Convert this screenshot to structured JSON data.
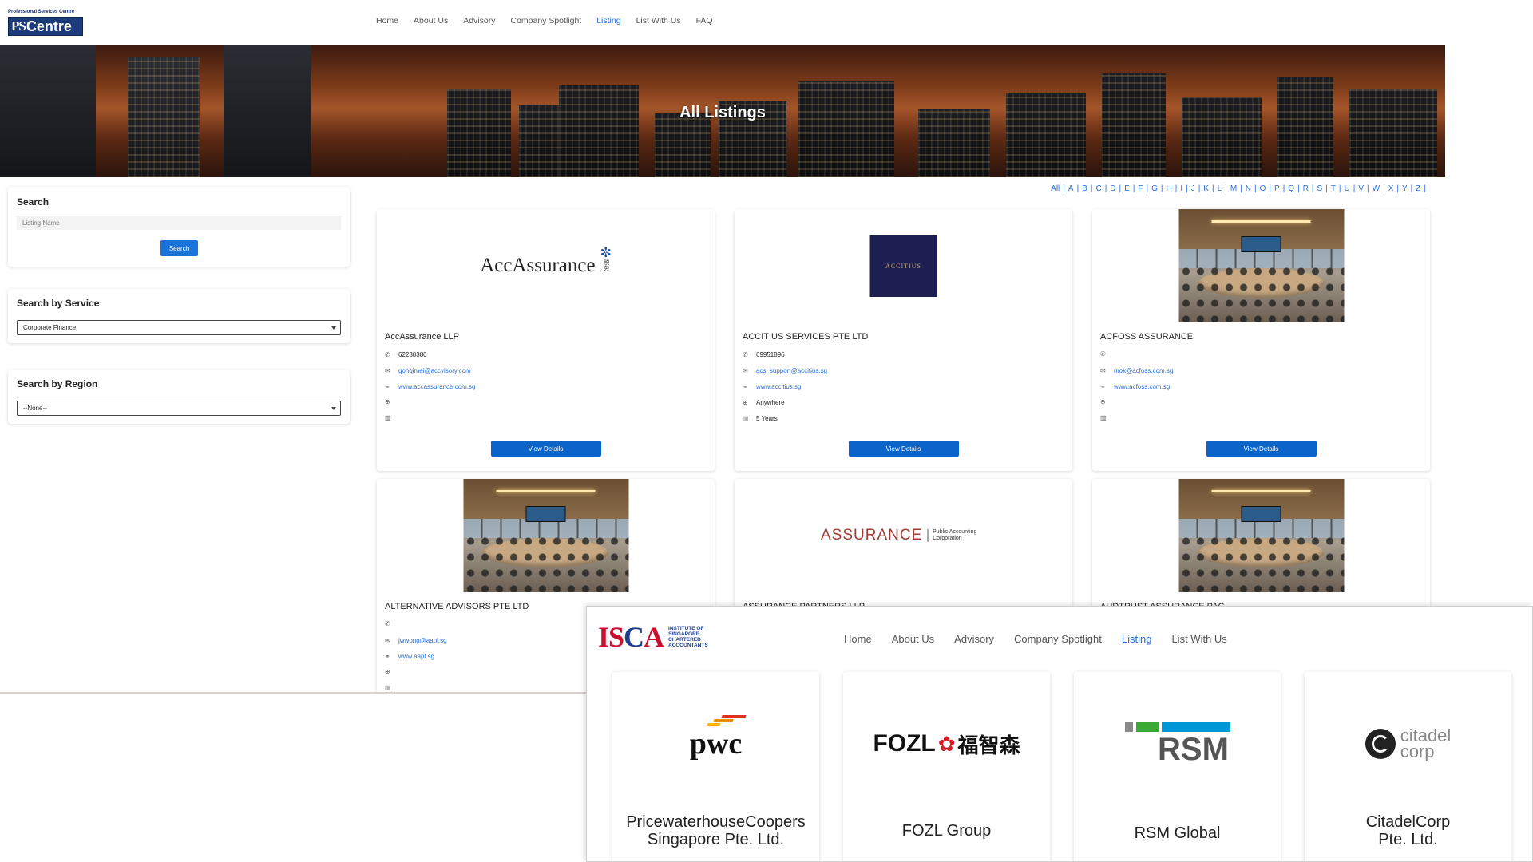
{
  "main": {
    "logo": {
      "top_text": "Professional Services Centre",
      "ps": "PS",
      "centre": "Centre"
    },
    "nav": [
      "Home",
      "About Us",
      "Advisory",
      "Company Spotlight",
      "Listing",
      "List With Us",
      "FAQ"
    ],
    "nav_active": "Listing",
    "hero_title": "All Listings",
    "search": {
      "title": "Search",
      "placeholder": "Listing Name",
      "button": "Search"
    },
    "service": {
      "title": "Search by Service",
      "value": "Corporate Finance"
    },
    "region": {
      "title": "Search by Region",
      "value": "--None--"
    },
    "alphabet": [
      "All",
      "A",
      "B",
      "C",
      "D",
      "E",
      "F",
      "G",
      "H",
      "I",
      "J",
      "K",
      "L",
      "M",
      "N",
      "O",
      "P",
      "Q",
      "R",
      "S",
      "T",
      "U",
      "V",
      "W",
      "X",
      "Y",
      "Z"
    ],
    "listings": [
      {
        "name": "AccAssurance LLP",
        "logo_text": "AccAssurance",
        "logo_side": "税务",
        "phone": "62238380",
        "email": "gohqimei@accvisory.com",
        "website": "www.accassurance.com.sg",
        "region": "",
        "experience": "",
        "button": "View Details"
      },
      {
        "name": "ACCITIUS SERVICES PTE LTD",
        "logo_text": "ACCITIUS",
        "phone": "69951896",
        "email": "acs_support@accitius.sg",
        "website": "www.accitius.sg",
        "region": "Anywhere",
        "experience": "5 Years",
        "button": "View Details"
      },
      {
        "name": "ACFOSS ASSURANCE",
        "phone": "",
        "email": "mok@acfoss.com.sg",
        "website": "www.acfoss.com.sg",
        "region": "",
        "experience": "",
        "button": "View Details"
      },
      {
        "name": "ALTERNATIVE ADVISORS PTE LTD",
        "phone": "",
        "email": "jwwong@aapl.sg",
        "website": "www.aapl.sg",
        "region": "",
        "experience": ""
      },
      {
        "name": "ASSURANCE PARTNERS LLP",
        "logo_text": "ASSURANCE",
        "logo_sub": "Public Accounting Corporation"
      },
      {
        "name": "AUDTRUST ASSURANCE PAC"
      }
    ]
  },
  "overlay": {
    "logo": {
      "word_a": "IS",
      "word_c": "C",
      "word_b": "A",
      "sub": [
        "INSTITUTE OF",
        "SINGAPORE",
        "CHARTERED",
        "ACCOUNTANTS"
      ]
    },
    "nav": [
      "Home",
      "About Us",
      "Advisory",
      "Company Spotlight",
      "Listing",
      "List With Us"
    ],
    "nav_active": "Listing",
    "cards": [
      {
        "name_l1": "PricewaterhouseCoopers",
        "name_l2": "Singapore Pte. Ltd.",
        "logo": "pwc"
      },
      {
        "name_l1": "FOZL Group",
        "name_l2": "",
        "logo": "FOZL",
        "logo_cn": "福智森"
      },
      {
        "name_l1": "RSM Global",
        "name_l2": "",
        "logo": "RSM"
      },
      {
        "name_l1": "CitadelCorp",
        "name_l2": "Pte. Ltd.",
        "logo_l1": "citadel",
        "logo_l2": "corp"
      }
    ]
  },
  "colors": {
    "accent": "#2a6fdb",
    "button": "#0c63c9",
    "isca_red": "#c8102e",
    "isca_blue": "#1d3f8c",
    "rsm_green": "#3aaa35",
    "rsm_blue": "#0097d7"
  }
}
